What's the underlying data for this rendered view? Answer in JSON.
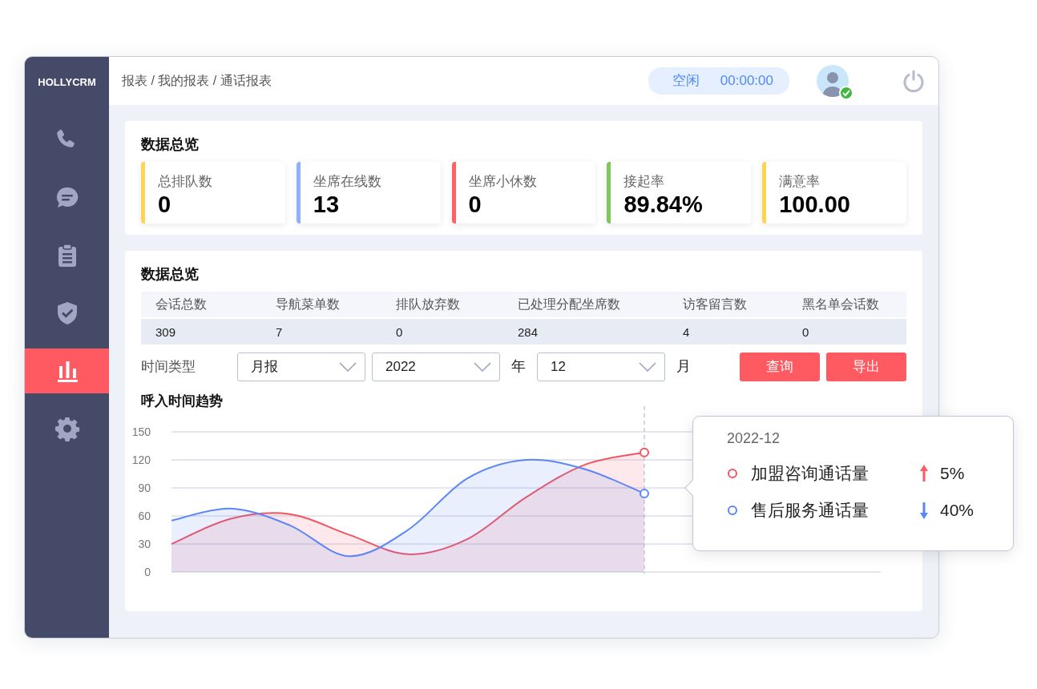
{
  "brand": "HOLLYCRM",
  "sidebar": {
    "items": [
      {
        "selected": false
      },
      {
        "selected": false
      },
      {
        "selected": false
      },
      {
        "selected": false
      },
      {
        "selected": true
      },
      {
        "selected": false
      }
    ]
  },
  "header": {
    "breadcrumb": "报表 / 我的报表 / 通话报表",
    "agent_status": "空闲",
    "timer": "00:00:00",
    "avatar_online": true
  },
  "overview": {
    "title": "数据总览",
    "stats": [
      {
        "label": "总排队数",
        "value": "0",
        "color": "#ffd54f"
      },
      {
        "label": "坐席在线数",
        "value": "13",
        "color": "#8fb0ff"
      },
      {
        "label": "坐席小休数",
        "value": "0",
        "color": "#ff6264"
      },
      {
        "label": "接起率",
        "value": "89.84%",
        "color": "#7ec75a"
      },
      {
        "label": "满意率",
        "value": "100.00",
        "color": "#ffd54f"
      }
    ]
  },
  "report": {
    "title": "数据总览",
    "table": {
      "columns": [
        "会话总数",
        "导航菜单数",
        "排队放弃数",
        "已处理分配坐席数",
        "访客留言数",
        "黑名单会话数"
      ],
      "rows": [
        [
          "309",
          "7",
          "0",
          "284",
          "4",
          "0"
        ]
      ]
    },
    "filter": {
      "label": "时间类型",
      "type_select": "月报",
      "year_select": "2022",
      "year_unit": "年",
      "month_select": "12",
      "month_unit": "月",
      "buttons": [
        "查询",
        "导出"
      ]
    },
    "chart_title": "呼入时间趋势",
    "chart_data": {
      "type": "area",
      "grid": true,
      "ylim": [
        0,
        150
      ],
      "yticks": [
        0,
        30,
        60,
        90,
        120,
        150
      ],
      "series": [
        {
          "name": "加盟咨询通话量",
          "color": "#f25461",
          "values": [
            30,
            57,
            62,
            40,
            19,
            35,
            80,
            115,
            128,
            null,
            null,
            null,
            null
          ]
        },
        {
          "name": "售后服务通话量",
          "color": "#5b86f5",
          "values": [
            55,
            68,
            50,
            17,
            45,
            100,
            120,
            110,
            84,
            null,
            null,
            null,
            null
          ]
        }
      ]
    },
    "tooltip": {
      "title": "2022-12",
      "rows": [
        {
          "rising": true,
          "value": "5%"
        },
        {
          "rising": false,
          "value": "40%"
        }
      ]
    }
  }
}
